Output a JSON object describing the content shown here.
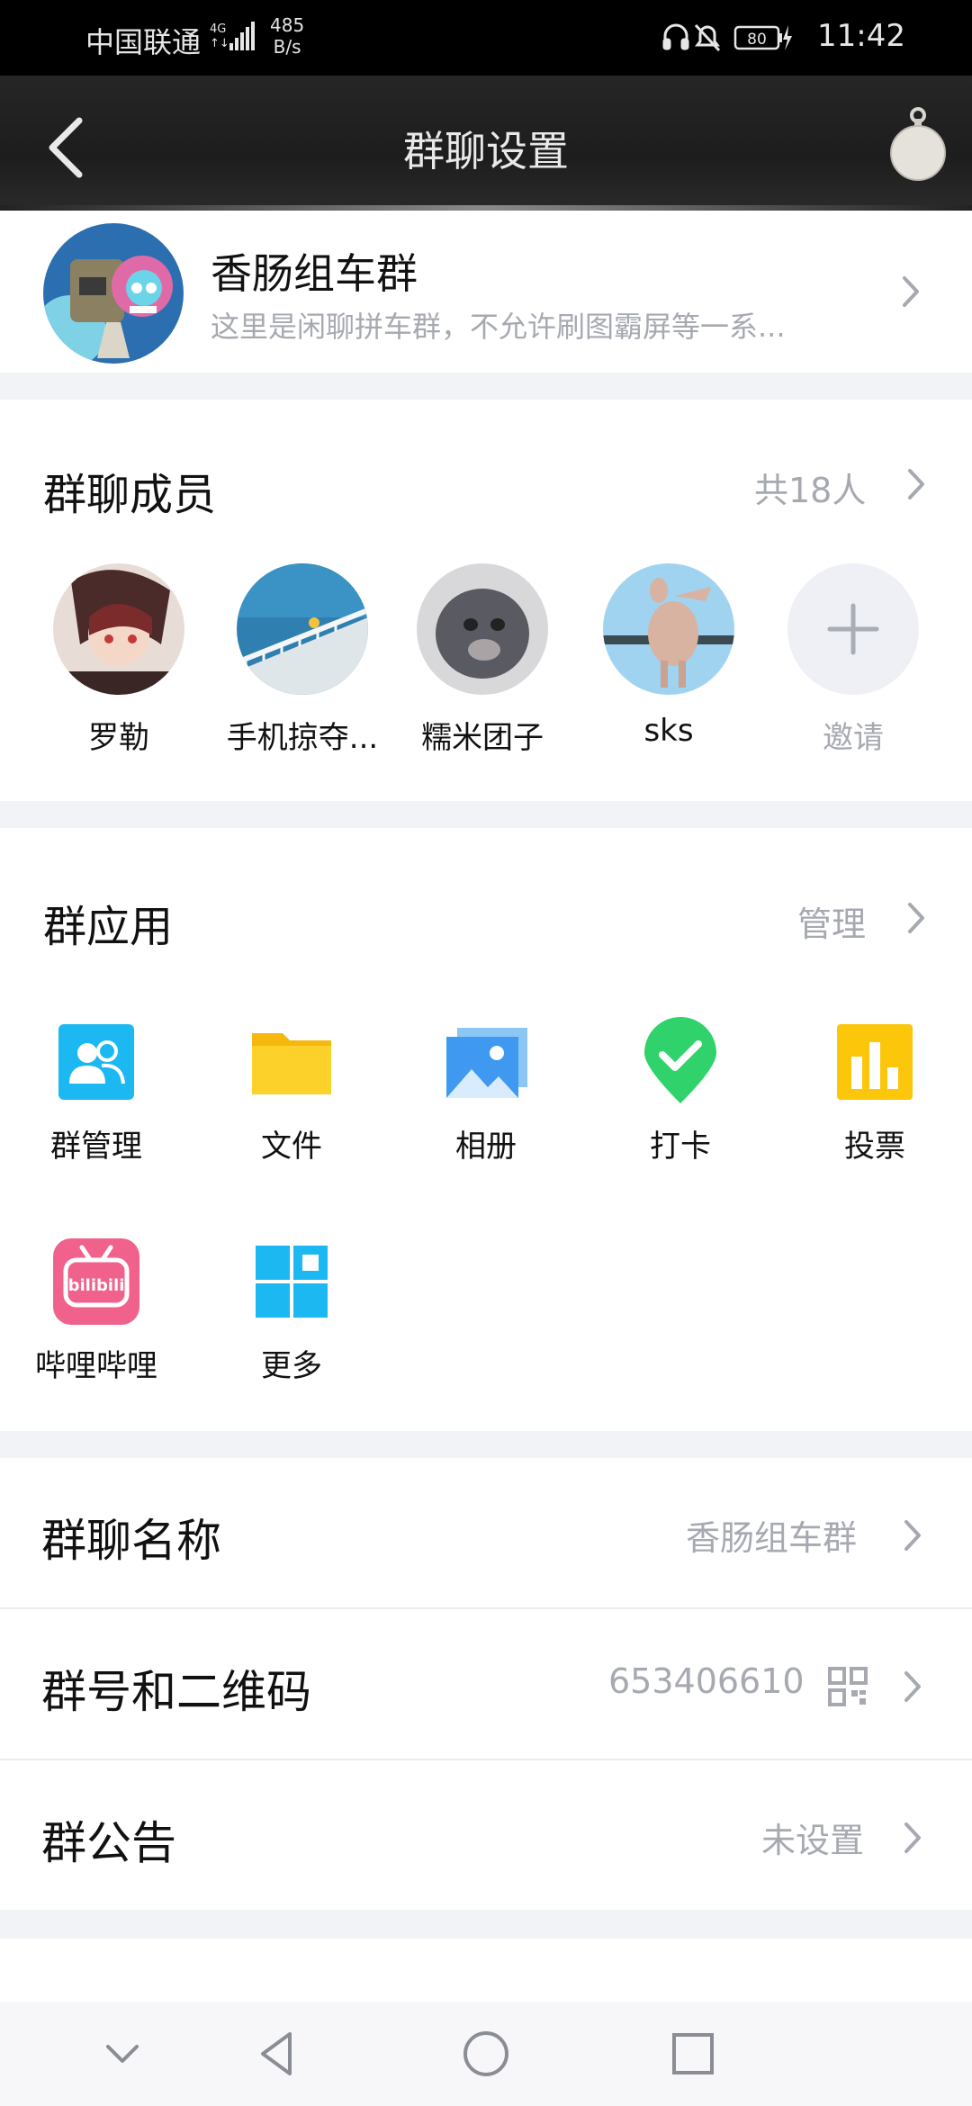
{
  "status_bar": {
    "carrier": "中国联通",
    "net_type": "4G",
    "speed_value": "485",
    "speed_unit": "B/s",
    "battery": "80",
    "time": "11:42"
  },
  "header": {
    "title": "群聊设置"
  },
  "group": {
    "name": "香肠组车群",
    "description": "这里是闲聊拼车群，不允许刷图霸屏等一系..."
  },
  "members": {
    "title": "群聊成员",
    "count_label": "共18人",
    "list": [
      {
        "name": "罗勒"
      },
      {
        "name": "手机掠夺..."
      },
      {
        "name": "糯米团子"
      },
      {
        "name": "sks"
      }
    ],
    "invite_label": "邀请"
  },
  "apps": {
    "title": "群应用",
    "manage_label": "管理",
    "items": [
      {
        "label": "群管理",
        "icon": "group-manage-icon"
      },
      {
        "label": "文件",
        "icon": "folder-icon"
      },
      {
        "label": "相册",
        "icon": "album-icon"
      },
      {
        "label": "打卡",
        "icon": "checkin-icon"
      },
      {
        "label": "投票",
        "icon": "vote-icon"
      },
      {
        "label": "哔哩哔哩",
        "icon": "bilibili-icon"
      },
      {
        "label": "更多",
        "icon": "more-apps-icon"
      }
    ]
  },
  "settings": {
    "group_name": {
      "label": "群聊名称",
      "value": "香肠组车群"
    },
    "group_id": {
      "label": "群号和二维码",
      "value": "653406610"
    },
    "announcement": {
      "label": "群公告",
      "value": "未设置"
    }
  },
  "colors": {
    "header_bg": "#1f1f1f",
    "page_bg": "#f2f3f7",
    "secondary_text": "#a6a9b0",
    "checkin_green": "#2fd26b",
    "vote_yellow": "#fcc60a",
    "app_blue": "#1cb8f1"
  }
}
